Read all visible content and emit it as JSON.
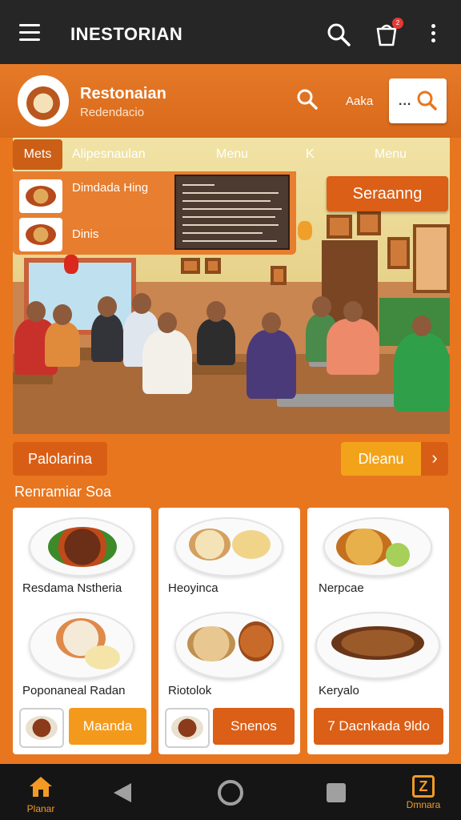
{
  "appbar": {
    "title": "INESTORIAN",
    "cart_badge": "2"
  },
  "header": {
    "name": "Restonaian",
    "subtitle": "Redendacio",
    "link": "Aaka",
    "search_box_prefix": "..."
  },
  "tabs": {
    "active": "Mets",
    "items": [
      "Alipesnaulan",
      "Menu",
      "K",
      "Menu"
    ]
  },
  "dropdown": {
    "items": [
      {
        "label": "Dimdada Hing"
      },
      {
        "label": "Dinis"
      }
    ]
  },
  "hero": {
    "button": "Seraanng"
  },
  "section": {
    "left_pill": "Palolarina",
    "right_pill": "Dleanu",
    "right_arrow": "›",
    "title": "Renramiar Soa"
  },
  "cards": [
    {
      "dish1": "Resdama Nstheria",
      "dish2": "Poponaneal Radan",
      "button": "Maanda"
    },
    {
      "dish1": "Heoyinca",
      "dish2": "Riotolok",
      "button": "Snenos"
    },
    {
      "dish1": "Nerpcae",
      "dish2": "Keryalo",
      "button": "7  Dacnkada 9ldo"
    }
  ],
  "navbar": {
    "home_label": "Planar",
    "end_label": "Dmnara",
    "end_icon": "Z"
  },
  "colors": {
    "primary": "#e8761f",
    "dark": "#262626",
    "accent": "#d95e15",
    "highlight": "#f3a31a"
  }
}
